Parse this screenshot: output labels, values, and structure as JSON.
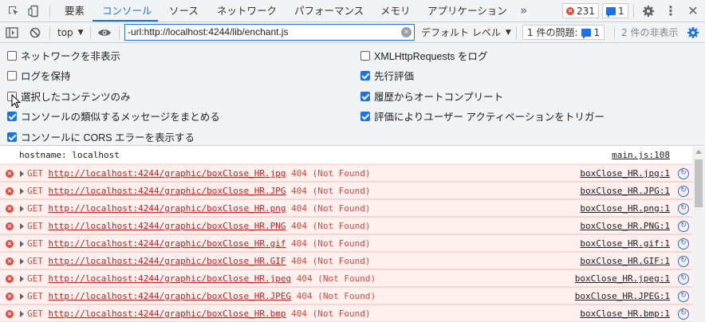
{
  "tabs": [
    {
      "label": "要素"
    },
    {
      "label": "コンソール"
    },
    {
      "label": "ソース"
    },
    {
      "label": "ネットワーク"
    },
    {
      "label": "パフォーマンス"
    },
    {
      "label": "メモリ"
    },
    {
      "label": "アプリケーション"
    }
  ],
  "more_tabs": "»",
  "error_count": "231",
  "message_count": "1",
  "toolbar": {
    "context": "top",
    "filter_value": "-url:http://localhost:4244/lib/enchant.js",
    "levels": "デフォルト レベル",
    "issues_label": "1 件の問題:",
    "issues_count": "1",
    "hidden_count": "2 件の非表示"
  },
  "settings": {
    "left": [
      {
        "label": "ネットワークを非表示",
        "checked": false
      },
      {
        "label": "ログを保持",
        "checked": false
      },
      {
        "label": "選択したコンテンツのみ",
        "checked": false
      },
      {
        "label": "コンソールの類似するメッセージをまとめる",
        "checked": true
      },
      {
        "label": "コンソールに CORS エラーを表示する",
        "checked": true
      }
    ],
    "right": [
      {
        "label": "XMLHttpRequests をログ",
        "checked": false
      },
      {
        "label": "先行評価",
        "checked": true
      },
      {
        "label": "履歴からオートコンプリート",
        "checked": true
      },
      {
        "label": "評価によりユーザー アクティベーションをトリガー",
        "checked": true
      }
    ]
  },
  "log": {
    "info": {
      "text": "hostname: localhost",
      "source": "main.js:108"
    },
    "errors": [
      {
        "method": "GET",
        "url": "http://localhost:4244/graphic/boxClose_HR.jpg",
        "status": "404 (Not Found)",
        "source": "boxClose_HR.jpg:1"
      },
      {
        "method": "GET",
        "url": "http://localhost:4244/graphic/boxClose_HR.JPG",
        "status": "404 (Not Found)",
        "source": "boxClose_HR.JPG:1"
      },
      {
        "method": "GET",
        "url": "http://localhost:4244/graphic/boxClose_HR.png",
        "status": "404 (Not Found)",
        "source": "boxClose_HR.png:1"
      },
      {
        "method": "GET",
        "url": "http://localhost:4244/graphic/boxClose_HR.PNG",
        "status": "404 (Not Found)",
        "source": "boxClose_HR.PNG:1"
      },
      {
        "method": "GET",
        "url": "http://localhost:4244/graphic/boxClose_HR.gif",
        "status": "404 (Not Found)",
        "source": "boxClose_HR.gif:1"
      },
      {
        "method": "GET",
        "url": "http://localhost:4244/graphic/boxClose_HR.GIF",
        "status": "404 (Not Found)",
        "source": "boxClose_HR.GIF:1"
      },
      {
        "method": "GET",
        "url": "http://localhost:4244/graphic/boxClose_HR.jpeg",
        "status": "404 (Not Found)",
        "source": "boxClose_HR.jpeg:1"
      },
      {
        "method": "GET",
        "url": "http://localhost:4244/graphic/boxClose_HR.JPEG",
        "status": "404 (Not Found)",
        "source": "boxClose_HR.JPEG:1"
      },
      {
        "method": "GET",
        "url": "http://localhost:4244/graphic/boxClose_HR.bmp",
        "status": "404 (Not Found)",
        "source": "boxClose_HR.bmp:1"
      }
    ]
  },
  "colors": {
    "accent": "#1a73e8",
    "error": "#e8453c",
    "error_bg": "#fff0f0"
  }
}
